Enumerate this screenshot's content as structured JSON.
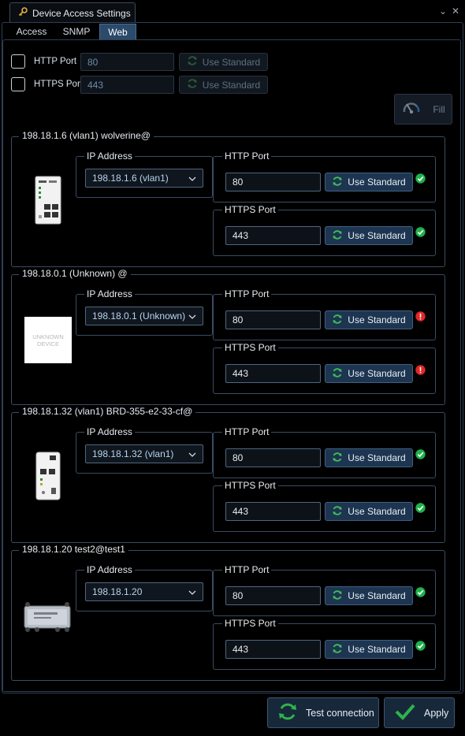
{
  "window": {
    "title": "Device Access Settings",
    "title_icon": "key-icon",
    "minimize_glyph": "⌄",
    "close_glyph": "✕"
  },
  "tabs": [
    {
      "label": "Access",
      "active": false
    },
    {
      "label": "SNMP",
      "active": false
    },
    {
      "label": "Web",
      "active": true
    }
  ],
  "global": {
    "http": {
      "label": "HTTP Port",
      "value": "80",
      "checked": false,
      "button": "Use Standard"
    },
    "https": {
      "label": "HTTPS Port",
      "value": "443",
      "checked": false,
      "button": "Use Standard"
    },
    "fill_label": "Fill"
  },
  "labels": {
    "ip_address": "IP Address",
    "http_port": "HTTP Port",
    "https_port": "HTTPS Port",
    "use_standard": "Use Standard",
    "unknown_device": "UNKNOWN\nDEVICE"
  },
  "devices": [
    {
      "title": "198.18.1.6 (vlan1) wolverine@",
      "ip": "198.18.1.6 (vlan1)",
      "http": "80",
      "https": "443",
      "http_status": "ok",
      "https_status": "ok",
      "image": "din-rail-switch"
    },
    {
      "title": "198.18.0.1 (Unknown) @",
      "ip": "198.18.0.1 (Unknown)",
      "http": "80",
      "https": "443",
      "http_status": "error",
      "https_status": "error",
      "image": "unknown-device"
    },
    {
      "title": "198.18.1.32 (vlan1) BRD-355-e2-33-cf@",
      "ip": "198.18.1.32 (vlan1)",
      "http": "80",
      "https": "443",
      "http_status": "ok",
      "https_status": "ok",
      "image": "router-module"
    },
    {
      "title": "198.18.1.20 test2@test1",
      "ip": "198.18.1.20",
      "http": "80",
      "https": "443",
      "http_status": "ok",
      "https_status": "ok",
      "image": "rugged-switch"
    }
  ],
  "footer": {
    "test_label": "Test connection",
    "apply_label": "Apply"
  },
  "colors": {
    "ok": "#1fb24a",
    "error": "#e02828",
    "accent": "#2c4a6a"
  }
}
